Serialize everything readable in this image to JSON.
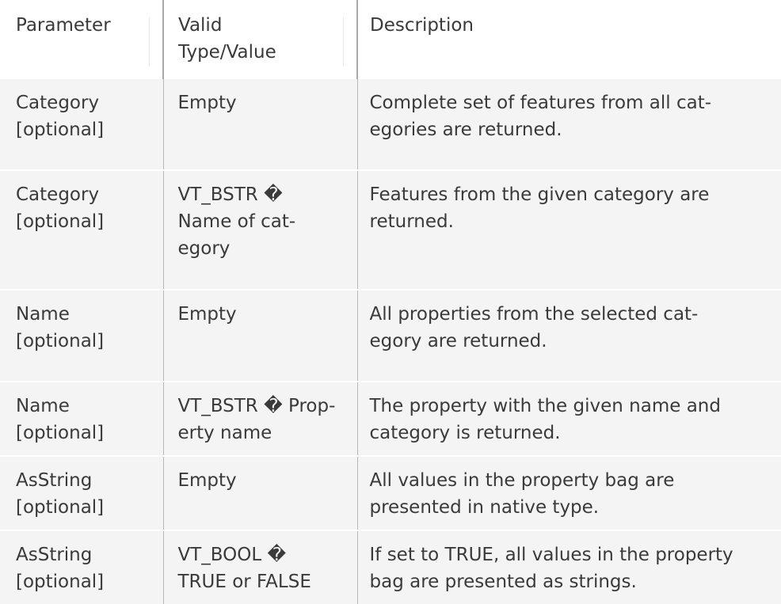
{
  "table": {
    "headers": [
      "Parameter",
      "Valid\nType/Value",
      "Description"
    ],
    "rows": [
      {
        "parameter": "Category\n[optional]",
        "value": "Empty",
        "description": "Complete set of features from all cat-\negories are returned."
      },
      {
        "parameter": "Category\n[optional]",
        "value": "VT_BSTR �\nName of cat-\negory",
        "description": "Features from the given category are\nreturned."
      },
      {
        "parameter": "Name\n[optional]",
        "value": "Empty",
        "description": "All properties from the selected cat-\negory are returned."
      },
      {
        "parameter": "Name\n[optional]",
        "value": "VT_BSTR � Prop-\nerty name",
        "description": "The property with the given name and\ncategory is returned."
      },
      {
        "parameter": "AsString\n[optional]",
        "value": "Empty",
        "description": "All values in the property bag are\npresented in native type."
      },
      {
        "parameter": "AsString\n[optional]",
        "value": "VT_BOOL �\nTRUE or FALSE",
        "description": "If set to TRUE, all values in the property\nbag are presented as strings."
      }
    ]
  }
}
